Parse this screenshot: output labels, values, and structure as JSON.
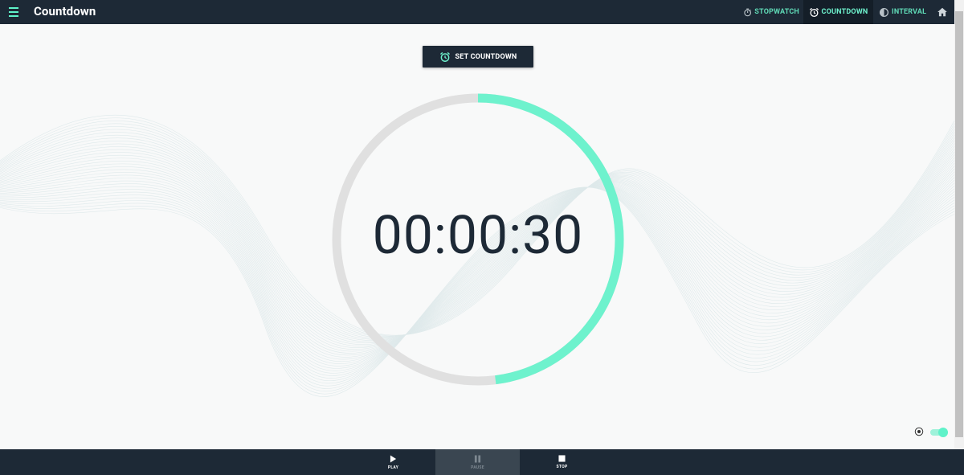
{
  "header": {
    "title": "Countdown",
    "nav": [
      {
        "label": "STOPWATCH",
        "icon": "stopwatch-icon"
      },
      {
        "label": "COUNTDOWN",
        "icon": "alarm-clock-icon",
        "active": true
      },
      {
        "label": "INTERVAL",
        "icon": "interval-icon"
      }
    ],
    "home_icon": "home-icon"
  },
  "set_button": {
    "label": "SET COUNTDOWN",
    "icon": "alarm-clock-icon"
  },
  "timer": {
    "display": "00:00:30",
    "progress": 0.48
  },
  "controls": [
    {
      "label": "PLAY",
      "icon": "play-icon"
    },
    {
      "label": "PAUSE",
      "icon": "pause-icon",
      "disabled": true
    },
    {
      "label": "STOP",
      "icon": "stop-icon"
    }
  ],
  "toggle": {
    "on": true
  },
  "colors": {
    "accent": "#6ef2cd",
    "bar": "#1d2936",
    "ring_track": "#e0e0e0",
    "background": "#f8f9f9"
  }
}
